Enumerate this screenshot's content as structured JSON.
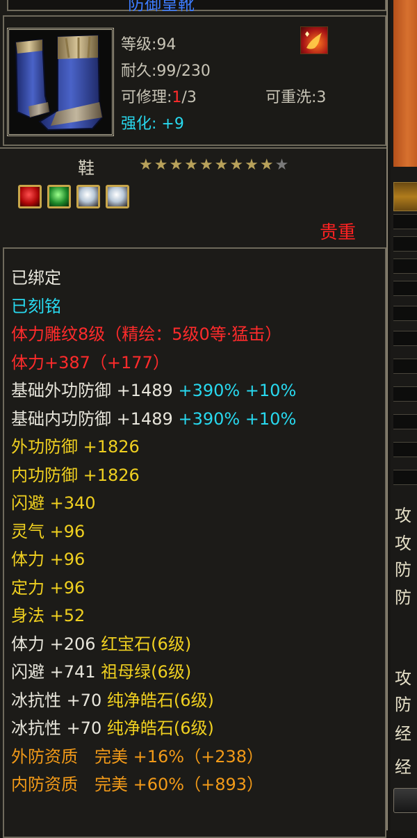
{
  "item": {
    "title": "防御皇靴",
    "stats": {
      "level_label": "等级:94",
      "durability_label": "耐久:99/230",
      "repair_prefix": "可修理:",
      "repair_count": "1",
      "repair_suffix": "/3",
      "reroll_label": "可重洗:3",
      "enhance_label": "强化: +9"
    },
    "type": "鞋",
    "stars_filled": 9,
    "stars_total": 10,
    "gems": [
      "ruby",
      "emerald",
      "pure-diamond",
      "pure-diamond"
    ],
    "rarity": "贵重",
    "icon_name": "blue-boots-icon",
    "badge_icon": "phoenix-emblem-icon"
  },
  "colors": {
    "white": "#e8e6dc",
    "cyan": "#28d9ef",
    "red": "#ff2b2b",
    "yellow": "#f0d020",
    "orange": "#f29a18",
    "gray": "#c8c4b6"
  },
  "attributes": [
    {
      "segments": [
        {
          "text": "已绑定",
          "color": "white"
        }
      ]
    },
    {
      "segments": [
        {
          "text": "已刻铭",
          "color": "cyan"
        }
      ]
    },
    {
      "segments": [
        {
          "text": "体力雕纹8级（精绘：5级0等·猛击）",
          "color": "red"
        }
      ]
    },
    {
      "segments": [
        {
          "text": "体力+387（+177）",
          "color": "red"
        }
      ]
    },
    {
      "segments": [
        {
          "text": "基础外功防御 +1489 ",
          "color": "white"
        },
        {
          "text": "+390% +10%",
          "color": "cyan"
        }
      ]
    },
    {
      "segments": [
        {
          "text": "基础内功防御 +1489 ",
          "color": "white"
        },
        {
          "text": "+390% +10%",
          "color": "cyan"
        }
      ]
    },
    {
      "segments": [
        {
          "text": "外功防御 +1826",
          "color": "yellow"
        }
      ]
    },
    {
      "segments": [
        {
          "text": "内功防御 +1826",
          "color": "yellow"
        }
      ]
    },
    {
      "segments": [
        {
          "text": "闪避 +340",
          "color": "yellow"
        }
      ]
    },
    {
      "segments": [
        {
          "text": "灵气 +96",
          "color": "yellow"
        }
      ]
    },
    {
      "segments": [
        {
          "text": "体力 +96",
          "color": "yellow"
        }
      ]
    },
    {
      "segments": [
        {
          "text": "定力 +96",
          "color": "yellow"
        }
      ]
    },
    {
      "segments": [
        {
          "text": "身法 +52",
          "color": "yellow"
        }
      ]
    },
    {
      "segments": [
        {
          "text": "体力 +206 ",
          "color": "white"
        },
        {
          "text": "红宝石(6级)",
          "color": "yellow"
        }
      ]
    },
    {
      "segments": [
        {
          "text": "闪避 +741 ",
          "color": "white"
        },
        {
          "text": "祖母绿(6级)",
          "color": "yellow"
        }
      ]
    },
    {
      "segments": [
        {
          "text": "冰抗性 +70 ",
          "color": "white"
        },
        {
          "text": "纯净皓石(6级)",
          "color": "yellow"
        }
      ]
    },
    {
      "segments": [
        {
          "text": "冰抗性 +70 ",
          "color": "white"
        },
        {
          "text": "纯净皓石(6级)",
          "color": "yellow"
        }
      ]
    },
    {
      "segments": [
        {
          "text": "外防资质　完美 +16%（+238）",
          "color": "orange"
        }
      ]
    },
    {
      "segments": [
        {
          "text": "内防资质　完美 +60%（+893）",
          "color": "orange"
        }
      ]
    }
  ],
  "background_window": {
    "labels": [
      "攻",
      "攻",
      "防",
      "防",
      "攻",
      "防",
      "经",
      "经"
    ]
  }
}
